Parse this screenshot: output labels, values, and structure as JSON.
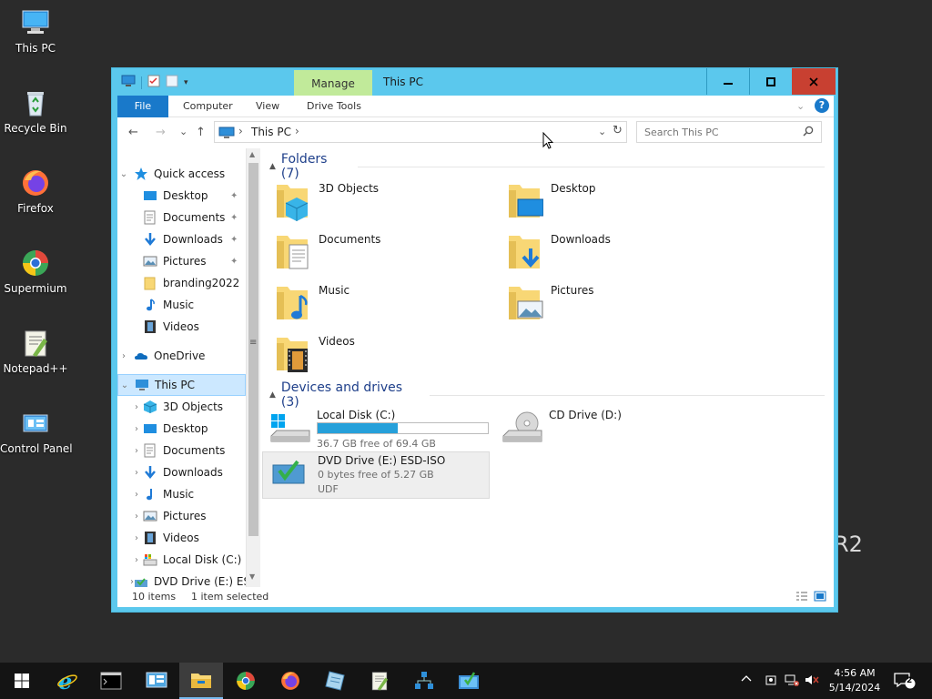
{
  "desktop": {
    "icons": [
      {
        "label": "This PC"
      },
      {
        "label": "Recycle Bin"
      },
      {
        "label": "Firefox"
      },
      {
        "label": "Supermium"
      },
      {
        "label": "Notepad++"
      },
      {
        "label": "Control Panel"
      }
    ],
    "watermark": "R2"
  },
  "window": {
    "title": "This PC",
    "contextual_tab": "Manage",
    "ribbon_tabs": {
      "file": "File",
      "computer": "Computer",
      "view": "View",
      "drive_tools": "Drive Tools"
    },
    "help_label": "?",
    "controls": {
      "minimize": "─",
      "maximize": "☐",
      "close": "✕"
    }
  },
  "navbar": {
    "back": "←",
    "forward": "→",
    "recent": "⌄",
    "up": "↑",
    "breadcrumb": [
      "This PC"
    ],
    "search_placeholder": "Search This PC"
  },
  "sidebar": {
    "quick_access": {
      "label": "Quick access",
      "items": [
        {
          "label": "Desktop",
          "icon": "desktop-icon",
          "pinned": true
        },
        {
          "label": "Documents",
          "icon": "documents-icon",
          "pinned": true
        },
        {
          "label": "Downloads",
          "icon": "downloads-icon",
          "pinned": true
        },
        {
          "label": "Pictures",
          "icon": "pictures-icon",
          "pinned": true
        },
        {
          "label": "branding2022",
          "icon": "folder-icon",
          "pinned": false
        },
        {
          "label": "Music",
          "icon": "music-icon",
          "pinned": false
        },
        {
          "label": "Videos",
          "icon": "videos-icon",
          "pinned": false
        }
      ]
    },
    "onedrive": {
      "label": "OneDrive"
    },
    "this_pc": {
      "label": "This PC",
      "items": [
        {
          "label": "3D Objects"
        },
        {
          "label": "Desktop"
        },
        {
          "label": "Documents"
        },
        {
          "label": "Downloads"
        },
        {
          "label": "Music"
        },
        {
          "label": "Pictures"
        },
        {
          "label": "Videos"
        },
        {
          "label": "Local Disk (C:)"
        },
        {
          "label": "DVD Drive (E:) ES"
        }
      ]
    }
  },
  "content": {
    "folders_header": "Folders (7)",
    "folders": [
      {
        "name": "3D Objects",
        "icon": "3d-objects-icon"
      },
      {
        "name": "Desktop",
        "icon": "desktop-icon"
      },
      {
        "name": "Documents",
        "icon": "documents-icon"
      },
      {
        "name": "Downloads",
        "icon": "downloads-icon"
      },
      {
        "name": "Music",
        "icon": "music-icon"
      },
      {
        "name": "Pictures",
        "icon": "pictures-icon"
      },
      {
        "name": "Videos",
        "icon": "videos-icon"
      }
    ],
    "drives_header": "Devices and drives (3)",
    "drives": [
      {
        "name": "Local Disk (C:)",
        "free_text": "36.7 GB free of 69.4 GB",
        "used_fraction": 0.47
      },
      {
        "name": "CD Drive (D:)"
      },
      {
        "name": "DVD Drive (E:) ESD-ISO",
        "free_text": "0 bytes free of 5.27 GB",
        "fs": "UDF"
      }
    ]
  },
  "status": {
    "items": "10 items",
    "selected": "1 item selected"
  },
  "taskbar": {
    "time": "4:56 AM",
    "date": "5/14/2024",
    "notifications": "2"
  },
  "colors": {
    "accent": "#1979ca",
    "titlebar": "#5bc8ed",
    "manage_tab": "#c1ea9a",
    "close": "#c84031",
    "selection": "#cce8ff"
  }
}
